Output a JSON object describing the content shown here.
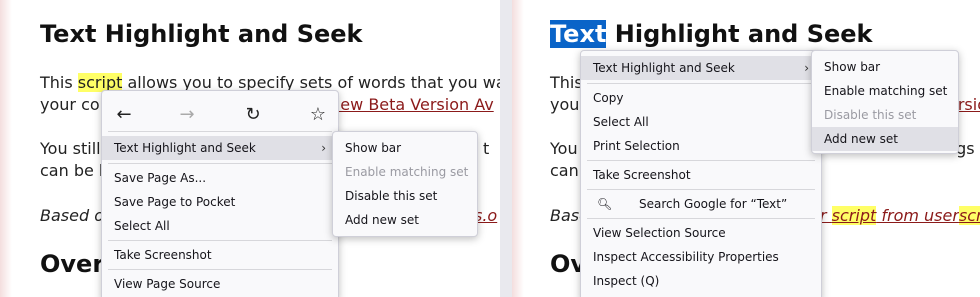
{
  "left": {
    "heading": "Text Highlight and Seek",
    "para1": {
      "pre": "This ",
      "hl": "script",
      "post": " allows you to specify sets of words that you want hi"
    },
    "para1_line2": {
      "pre": "your con",
      "post": "e: ",
      "link": "New Beta Version Av"
    },
    "para2_line1": {
      "pre": "You still",
      "post": "on t"
    },
    "para2_line2": "can be b",
    "para3": {
      "pre": "Based o",
      "link": "s.o"
    },
    "heading2": "Overv",
    "nav": {
      "back": "←",
      "forward": "→",
      "reload": "↻",
      "bookmark": "☆"
    },
    "menu": {
      "item_ths": "Text Highlight and Seek",
      "item_save_as": "Save Page As...",
      "item_pocket": "Save Page to Pocket",
      "item_select_all": "Select All",
      "item_screenshot": "Take Screenshot",
      "item_view_source": "View Page Source"
    },
    "submenu": {
      "show_bar": "Show bar",
      "enable_matching": "Enable matching set",
      "disable_set": "Disable this set",
      "add_new": "Add new set"
    }
  },
  "right": {
    "heading_sel": "Text",
    "heading_rest": " Highlight and Seek",
    "para1_pre": "This",
    "para1_line2_pre": "your",
    "para1_line2_link": "ersio",
    "para2_pre": "You",
    "para2_post": "ngs",
    "para2_line2": "can",
    "para3_pre": "Base",
    "para3_link_a": "r ",
    "para3_hl1": "script",
    "para3_mid": " from user",
    "para3_hl2": "scrip",
    "heading2": "Ov",
    "menu": {
      "item_ths": "Text Highlight and Seek",
      "item_copy": "Copy",
      "item_select_all": "Select All",
      "item_print_sel": "Print Selection",
      "item_screenshot": "Take Screenshot",
      "item_search": "Search Google for “Text”",
      "item_view_sel_source": "View Selection Source",
      "item_inspect_access": "Inspect Accessibility Properties",
      "item_inspect": "Inspect (Q)"
    },
    "submenu": {
      "show_bar": "Show bar",
      "enable_matching": "Enable matching set",
      "disable_set": "Disable this set",
      "add_new": "Add new set"
    }
  },
  "arrow_glyph": "›"
}
